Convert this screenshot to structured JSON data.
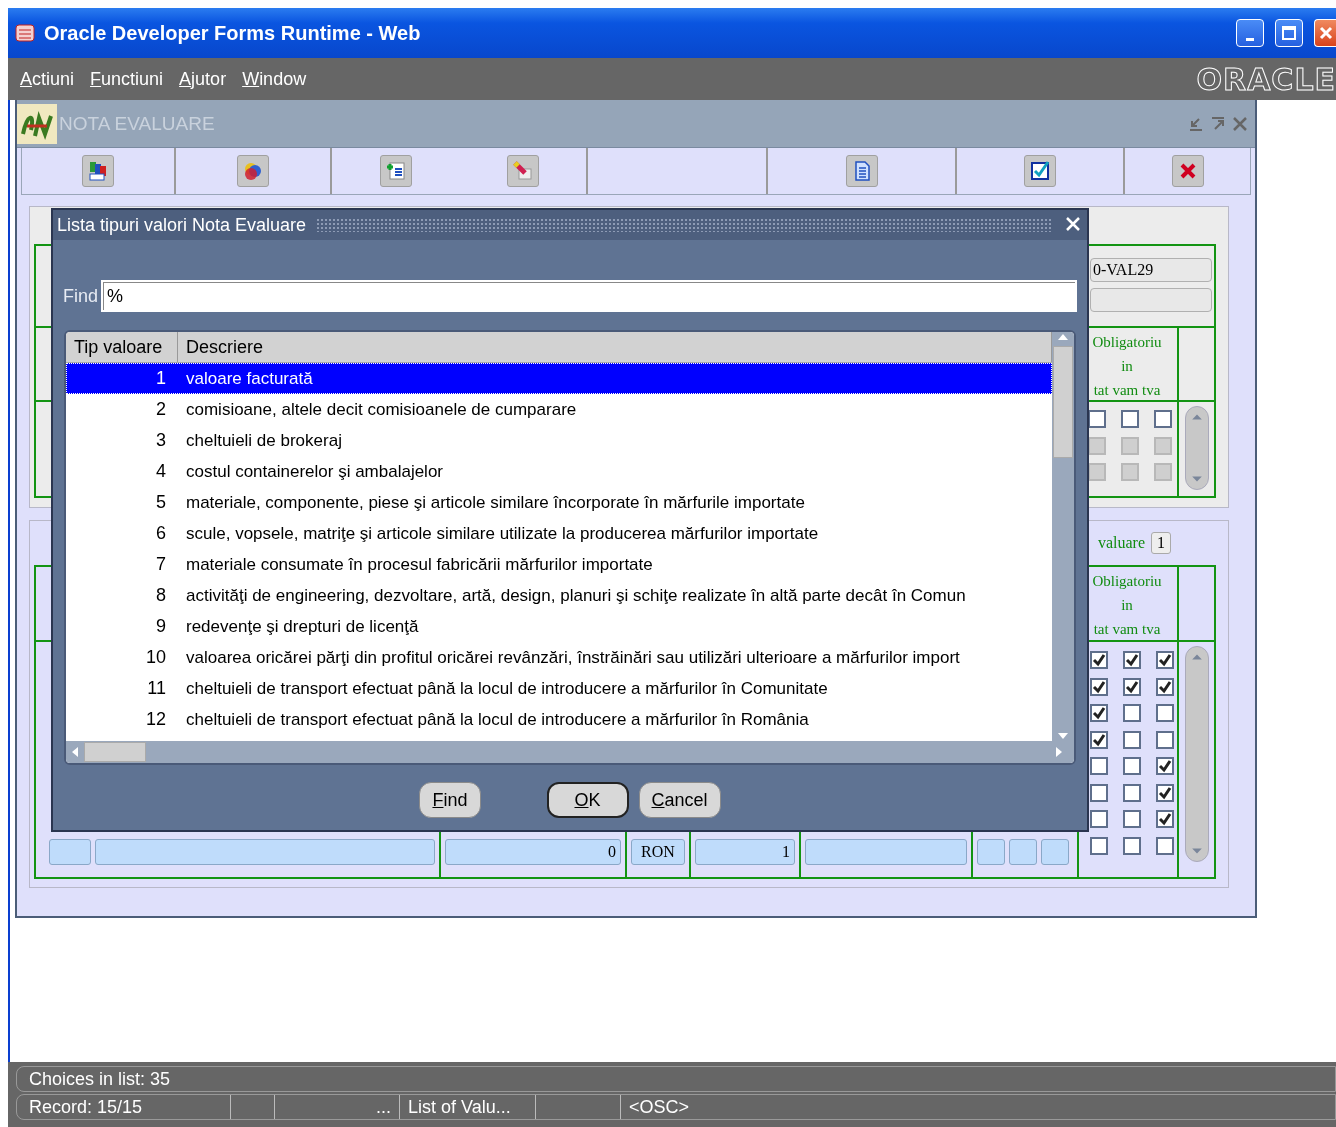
{
  "app_window": {
    "title": "Oracle Developer Forms Runtime - Web"
  },
  "menu": [
    {
      "label": "Actiuni"
    },
    {
      "label": "Functiuni"
    },
    {
      "label": "Ajutor"
    },
    {
      "label": "Window"
    }
  ],
  "brand": "ORACLE",
  "form_window": {
    "title": "NOTA EVALUARE"
  },
  "upper_block": {
    "field_value": "0-VAL29",
    "header_lines": [
      "Obligatoriu",
      "in",
      "tat vam tva"
    ],
    "rows": [
      {
        "disabled": false,
        "cells": [
          {
            "checked": false
          },
          {
            "checked": false
          },
          {
            "checked": false
          }
        ]
      },
      {
        "disabled": true,
        "cells": [
          {
            "checked": false
          },
          {
            "checked": false
          },
          {
            "checked": false
          }
        ]
      },
      {
        "disabled": true,
        "cells": [
          {
            "checked": false
          },
          {
            "checked": false
          },
          {
            "checked": false
          }
        ]
      }
    ]
  },
  "lower_block": {
    "label": "valuare",
    "label_value": "1",
    "header_lines": [
      "Obligatoriu",
      "in",
      "tat vam tva"
    ],
    "record_fields": {
      "amount": "0",
      "currency": "RON",
      "rate": "1"
    },
    "rows": [
      {
        "cells": [
          {
            "checked": true
          },
          {
            "checked": true
          },
          {
            "checked": true
          }
        ]
      },
      {
        "cells": [
          {
            "checked": true
          },
          {
            "checked": true
          },
          {
            "checked": true
          }
        ]
      },
      {
        "cells": [
          {
            "checked": true
          },
          {
            "checked": false
          },
          {
            "checked": false
          }
        ]
      },
      {
        "cells": [
          {
            "checked": true
          },
          {
            "checked": false
          },
          {
            "checked": false
          }
        ]
      },
      {
        "cells": [
          {
            "checked": false
          },
          {
            "checked": false
          },
          {
            "checked": true
          }
        ]
      },
      {
        "cells": [
          {
            "checked": false
          },
          {
            "checked": false
          },
          {
            "checked": true
          }
        ]
      },
      {
        "cells": [
          {
            "checked": false
          },
          {
            "checked": false
          },
          {
            "checked": true
          }
        ]
      },
      {
        "cells": [
          {
            "checked": false
          },
          {
            "checked": false
          },
          {
            "checked": false
          }
        ]
      }
    ]
  },
  "dialog": {
    "title": "Lista tipuri valori Nota Evaluare",
    "find_label": "Find",
    "find_value": "%",
    "columns": [
      "Tip valoare",
      "Descriere"
    ],
    "rows": [
      {
        "tip": "1",
        "descriere": "valoare facturată",
        "selected": true
      },
      {
        "tip": "2",
        "descriere": "comisioane, altele decit comisioanele de cumparare",
        "selected": false
      },
      {
        "tip": "3",
        "descriere": "cheltuieli de brokeraj",
        "selected": false
      },
      {
        "tip": "4",
        "descriere": "costul containerelor şi ambalajelor",
        "selected": false
      },
      {
        "tip": "5",
        "descriere": "materiale, componente, piese şi articole similare încorporate în mărfurile importate",
        "selected": false
      },
      {
        "tip": "6",
        "descriere": "scule, vopsele, matriţe şi articole similare utilizate la producerea mărfurilor importate",
        "selected": false
      },
      {
        "tip": "7",
        "descriere": "materiale consumate în procesul fabricării mărfurilor importate",
        "selected": false
      },
      {
        "tip": "8",
        "descriere": "activităţi de engineering, dezvoltare, artă, design, planuri şi schiţe realizate în altă parte decât în Comun",
        "selected": false
      },
      {
        "tip": "9",
        "descriere": "redevenţe şi drepturi de licenţă",
        "selected": false
      },
      {
        "tip": "10",
        "descriere": "valoarea oricărei părţi din profitul oricărei revânzări, înstrăinări sau utilizări ulterioare a mărfurilor import",
        "selected": false
      },
      {
        "tip": "11",
        "descriere": "cheltuieli de transport efectuat până la locul de introducere a mărfurilor în Comunitate",
        "selected": false
      },
      {
        "tip": "12",
        "descriere": "cheltuieli de transport efectuat până la locul de introducere a mărfurilor în România",
        "selected": false
      }
    ],
    "buttons": [
      {
        "label": "Find",
        "default": false
      },
      {
        "label": "OK",
        "default": true
      },
      {
        "label": "Cancel",
        "default": false
      }
    ]
  },
  "status_bar": {
    "message": "Choices in list: 35",
    "record": "Record: 15/15",
    "ellipsis": "...",
    "mode": "List of Valu...",
    "osc": "<OSC>"
  }
}
